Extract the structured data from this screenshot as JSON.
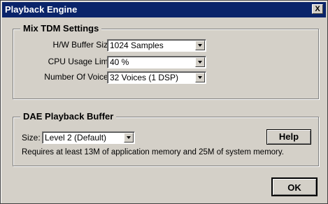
{
  "window": {
    "title": "Playback Engine",
    "close_label": "X"
  },
  "mix_tdm": {
    "title": "Mix TDM Settings",
    "hw_buffer": {
      "label": "H/W Buffer Size:",
      "value": "1024 Samples"
    },
    "cpu_usage": {
      "label": "CPU Usage Limit:",
      "value": "40 %"
    },
    "voices": {
      "label": "Number Of Voices:",
      "value": "32 Voices (1 DSP)"
    }
  },
  "dae": {
    "title": "DAE Playback Buffer",
    "size": {
      "label": "Size:",
      "value": "Level 2 (Default)"
    },
    "help_label": "Help",
    "info": "Requires at least 13M of application memory and 25M of system memory."
  },
  "ok_label": "OK"
}
